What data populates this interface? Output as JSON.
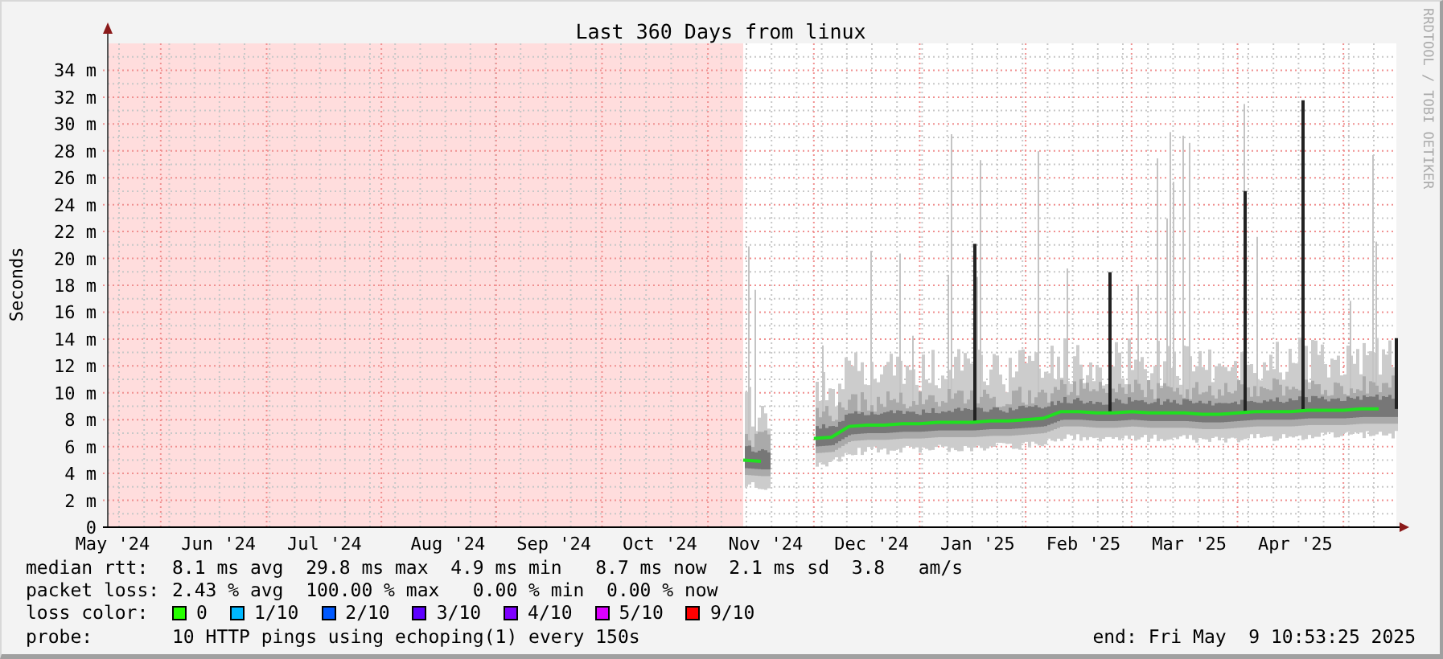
{
  "title": "Last 360 Days from linux",
  "credit": "RRDTOOL / TOBI OETIKER",
  "chart_data": {
    "type": "line",
    "ylabel": "Seconds",
    "categories": [
      "May '24",
      null,
      null,
      null,
      null,
      null,
      "Jun '24",
      null,
      null,
      null,
      null,
      null,
      "Jul '24",
      null,
      null,
      null,
      null,
      null,
      null,
      "Aug '24",
      null,
      null,
      null,
      null,
      null,
      "Sep '24",
      null,
      null,
      null,
      null,
      null,
      "Oct '24",
      null,
      null,
      null,
      null,
      null,
      "Nov '24",
      null,
      null,
      null,
      null,
      null,
      "Dec '24",
      null,
      null,
      null,
      null,
      null,
      "Jan '25",
      null,
      null,
      null,
      null,
      null,
      "Feb '25",
      null,
      null,
      null,
      null,
      null,
      "Mar '25",
      null,
      null,
      null,
      null,
      null,
      "Apr '25",
      null,
      null,
      null,
      null,
      null
    ],
    "series": [
      {
        "color": "#20e020",
        "values": [
          null,
          null,
          null,
          null,
          null,
          null,
          null,
          null,
          null,
          null,
          null,
          null,
          null,
          null,
          null,
          null,
          null,
          null,
          null,
          null,
          null,
          null,
          null,
          null,
          null,
          null,
          null,
          null,
          null,
          null,
          null,
          null,
          null,
          null,
          null,
          null,
          5.0,
          4.9,
          null,
          null,
          6.6,
          6.7,
          7.5,
          7.6,
          7.6,
          7.7,
          7.7,
          7.8,
          7.8,
          7.8,
          7.9,
          7.9,
          8.0,
          8.1,
          8.6,
          8.6,
          8.5,
          8.5,
          8.6,
          8.5,
          8.5,
          8.5,
          8.4,
          8.4,
          8.5,
          8.6,
          8.6,
          8.6,
          8.7,
          8.7,
          8.7,
          8.8,
          8.8
        ]
      }
    ],
    "ylim": [
      0,
      36
    ],
    "grid": true,
    "yticks": [
      {
        "value": 0,
        "label": "0"
      },
      {
        "value": 2,
        "label": "2 m"
      },
      {
        "value": 4,
        "label": "4 m"
      },
      {
        "value": 6,
        "label": "6 m"
      },
      {
        "value": 8,
        "label": "8 m"
      },
      {
        "value": 10,
        "label": "10 m"
      },
      {
        "value": 12,
        "label": "12 m"
      },
      {
        "value": 14,
        "label": "14 m"
      },
      {
        "value": 16,
        "label": "16 m"
      },
      {
        "value": 18,
        "label": "18 m"
      },
      {
        "value": 20,
        "label": "20 m"
      },
      {
        "value": 22,
        "label": "22 m"
      },
      {
        "value": 24,
        "label": "24 m"
      },
      {
        "value": 26,
        "label": "26 m"
      },
      {
        "value": 28,
        "label": "28 m"
      },
      {
        "value": 30,
        "label": "30 m"
      },
      {
        "value": 32,
        "label": "32 m"
      },
      {
        "value": 34,
        "label": "34 m"
      }
    ]
  },
  "legend": [
    {
      "label": "median rtt:",
      "text": "8.1 ms avg  29.8 ms max  4.9 ms min   8.7 ms now  2.1 ms sd  3.8   am/s"
    },
    {
      "label": "packet loss:",
      "text": "2.43 % avg  100.00 % max   0.00 % min  0.00 % now"
    }
  ],
  "loss_color": {
    "label": "loss color:",
    "items": [
      {
        "label": "0",
        "color": "#26ff00"
      },
      {
        "label": "1/10",
        "color": "#00b8ff"
      },
      {
        "label": "2/10",
        "color": "#0059ff"
      },
      {
        "label": "3/10",
        "color": "#5e00ff"
      },
      {
        "label": "4/10",
        "color": "#7e00ff"
      },
      {
        "label": "5/10",
        "color": "#dd00ff"
      },
      {
        "label": "9/10",
        "color": "#ff0000"
      }
    ]
  },
  "probe": {
    "label": "probe:",
    "text": "10 HTTP pings using echoping(1) every 150s"
  },
  "end": "end: Fri May  9 10:53:25 2025"
}
